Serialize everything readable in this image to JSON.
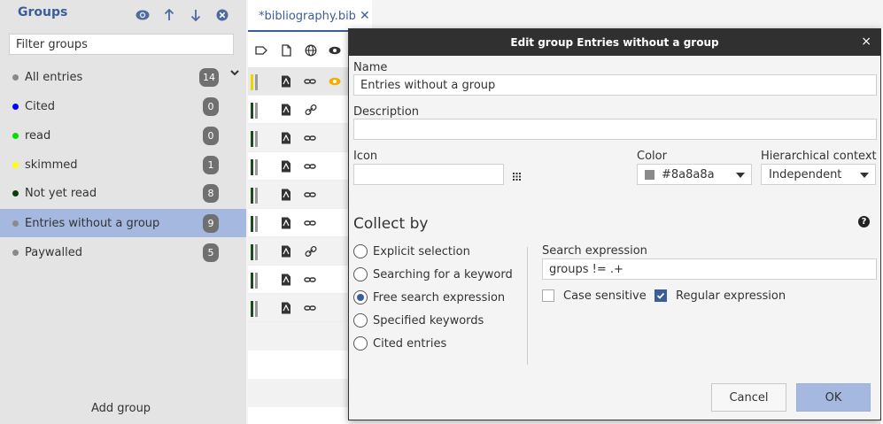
{
  "sidebar": {
    "title": "Groups",
    "filter_placeholder": "Filter groups",
    "toolbar_icons": [
      "eye-icon",
      "arrow-up-icon",
      "arrow-down-icon",
      "close-circle-icon"
    ],
    "groups": [
      {
        "label": "All entries",
        "count": "14",
        "color": "#8a8a8a"
      },
      {
        "label": "Cited",
        "count": "0",
        "color": "#0000ff"
      },
      {
        "label": "read",
        "count": "0",
        "color": "#00e000"
      },
      {
        "label": "skimmed",
        "count": "1",
        "color": "#ffff00"
      },
      {
        "label": "Not yet read",
        "count": "8",
        "color": "#0a3d0a"
      },
      {
        "label": "Entries without a group",
        "count": "9",
        "color": "#8a8a8a"
      },
      {
        "label": "Paywalled",
        "count": "5",
        "color": "#8a8a8a"
      }
    ],
    "add_group_label": "Add group"
  },
  "main": {
    "tab": {
      "label": "*bibliography.bib",
      "close": "✕"
    },
    "header_icons": [
      "label-icon",
      "file-icon",
      "globe-icon",
      "eye-icon"
    ],
    "rows": [
      {
        "bar_color": "#e6d800",
        "link_icon": "link-icon",
        "read": true
      },
      {
        "bar_color": "#1a4d1a",
        "link_icon": "chain-icon",
        "read": false
      },
      {
        "bar_color": "#1a4d1a",
        "link_icon": "link-icon",
        "read": false
      },
      {
        "bar_color": "#1a4d1a",
        "link_icon": "link-icon",
        "read": false
      },
      {
        "bar_color": "#1a4d1a",
        "link_icon": "link-icon",
        "read": false
      },
      {
        "bar_color": "#1a4d1a",
        "link_icon": "link-icon",
        "read": false
      },
      {
        "bar_color": "#1a4d1a",
        "link_icon": "chain-icon",
        "read": false
      },
      {
        "bar_color": "#1a4d1a",
        "link_icon": "link-icon",
        "read": false
      },
      {
        "bar_color": "#1a4d1a",
        "link_icon": "link-icon",
        "read": false
      }
    ]
  },
  "dialog": {
    "title": "Edit group Entries without a group",
    "close": "×",
    "name_label": "Name",
    "name_value": "Entries without a group",
    "description_label": "Description",
    "description_value": "",
    "icon_label": "Icon",
    "icon_value": "",
    "color_label": "Color",
    "color_value": "#8a8a8a",
    "color_swatch": "#8a8a8a",
    "hierarchical_label": "Hierarchical context",
    "hierarchical_value": "Independent",
    "collect_by_title": "Collect by",
    "collect_options": [
      {
        "label": "Explicit selection",
        "checked": false
      },
      {
        "label": "Searching for a keyword",
        "checked": false
      },
      {
        "label": "Free search expression",
        "checked": true
      },
      {
        "label": "Specified keywords",
        "checked": false
      },
      {
        "label": "Cited entries",
        "checked": false
      }
    ],
    "search_expression_label": "Search expression",
    "search_expression_value": "groups != .+",
    "case_sensitive_label": "Case sensitive",
    "case_sensitive_checked": false,
    "regex_label": "Regular expression",
    "regex_checked": true,
    "cancel_label": "Cancel",
    "ok_label": "OK"
  },
  "colors": {
    "accent": "#3c5d99",
    "selection": "#a4b8e0",
    "titlebar": "#303030",
    "badge": "#707070"
  }
}
